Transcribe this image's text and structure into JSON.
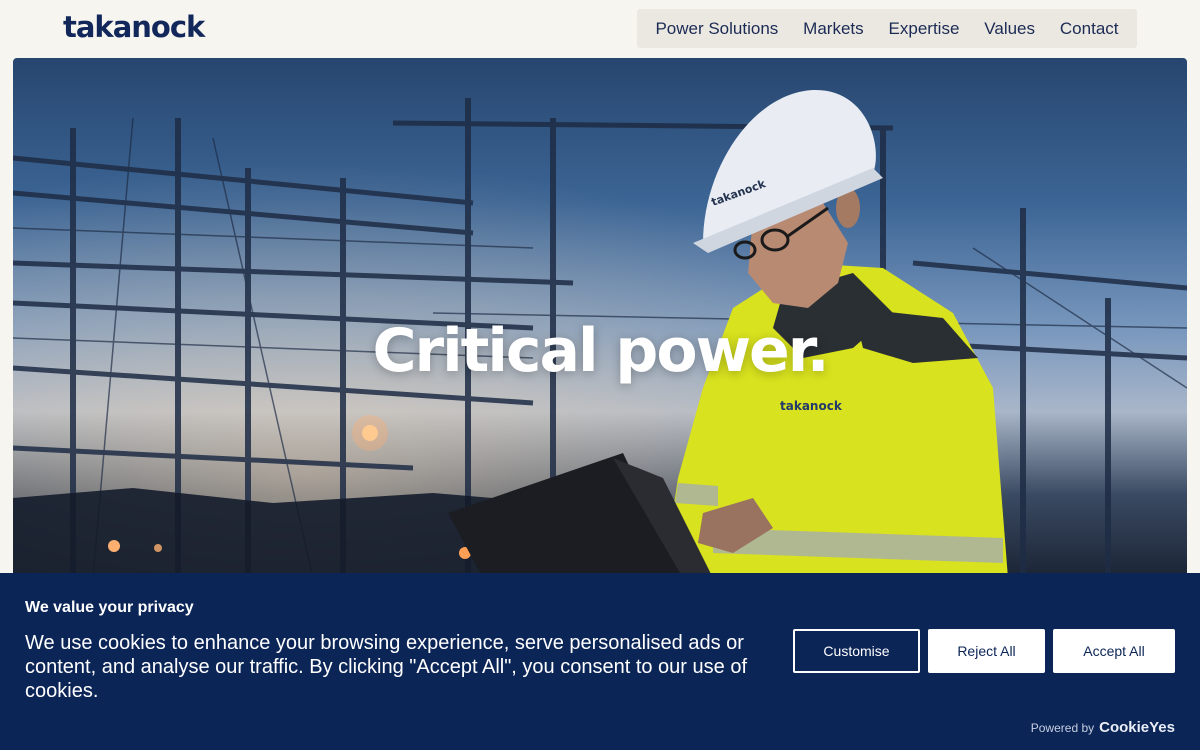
{
  "header": {
    "logo": "takanock",
    "nav": [
      "Power Solutions",
      "Markets",
      "Expertise",
      "Values",
      "Contact"
    ]
  },
  "hero": {
    "title": "Critical power.",
    "helmet_text": "takanock",
    "jacket_text": "takanock"
  },
  "cookie_banner": {
    "title": "We value your privacy",
    "text": "We use cookies to enhance your browsing experience, serve personalised ads or content, and analyse our traffic. By clicking \"Accept All\", you consent to our use of cookies.",
    "buttons": {
      "customise": "Customise",
      "reject": "Reject All",
      "accept": "Accept All"
    },
    "powered_by": "Powered by",
    "provider": "CookieYes"
  },
  "colors": {
    "brand_navy": "#13285a",
    "banner_bg": "#0c2557",
    "page_bg": "#f7f5f0",
    "nav_bg": "#ebe8e1",
    "jacket_yellow": "#d8e21e"
  }
}
